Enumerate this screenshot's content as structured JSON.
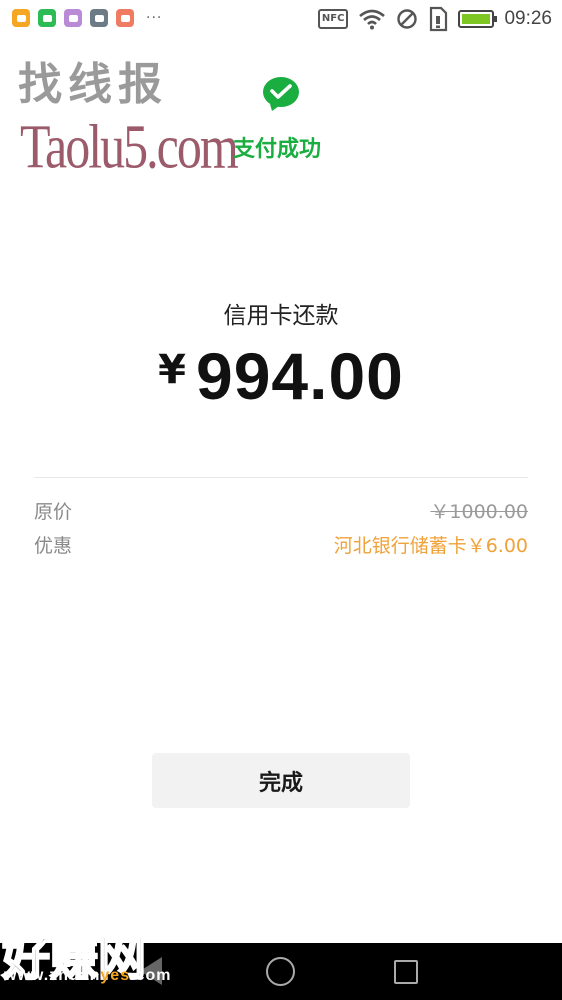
{
  "status_bar": {
    "time": "09:26",
    "nfc_label": "NFC",
    "notification_icons": [
      {
        "name": "app-notification-icon",
        "color": "#f5a623"
      },
      {
        "name": "wechat-notification-icon",
        "color": "#2dbb56"
      },
      {
        "name": "gallery-notification-icon",
        "color": "#b98ad6"
      },
      {
        "name": "message-notification-icon",
        "color": "#6d7b86"
      },
      {
        "name": "app-notification-icon",
        "color": "#ef7b63"
      }
    ],
    "overflow": "···",
    "icons": [
      "nfc-icon",
      "wifi-icon",
      "do-not-disturb-icon",
      "sim-icon",
      "battery-icon"
    ]
  },
  "watermark": {
    "top_text": "找线报",
    "top_url": "Taolu5.com",
    "bottom_text": "好赚网",
    "bottom_url_prefix": "www.zhuan",
    "bottom_url_highlight": "yes",
    "bottom_url_suffix": ".com"
  },
  "header": {
    "status_text": "支付成功",
    "icon": "wechat-pay-icon"
  },
  "payment": {
    "merchant": "信用卡还款",
    "currency_symbol": "¥",
    "amount": "994.00"
  },
  "details": {
    "original_label": "原价",
    "original_value": "￥1000.00",
    "discount_label": "优惠",
    "discount_value": "河北银行储蓄卡￥6.00"
  },
  "actions": {
    "done_label": "完成"
  },
  "nav_bar": {
    "buttons": [
      "back-button",
      "home-button",
      "recents-button"
    ]
  },
  "colors": {
    "success_green": "#1aad3f",
    "discount_orange": "#f0a23a",
    "muted_text": "#8a8a8a",
    "button_bg": "#f2f2f2"
  }
}
